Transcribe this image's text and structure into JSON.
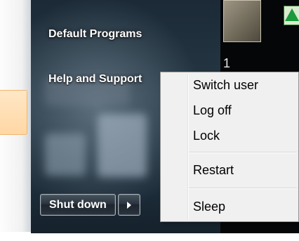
{
  "start_menu": {
    "items": [
      {
        "label": "Default Programs"
      },
      {
        "label": "Help and Support"
      }
    ],
    "shutdown_label": "Shut down"
  },
  "power_menu": {
    "items": [
      {
        "label": "Switch user"
      },
      {
        "label": "Log off"
      },
      {
        "label": "Lock"
      },
      {
        "label": "Restart"
      },
      {
        "label": "Sleep"
      }
    ]
  },
  "desktop": {
    "stray_text": "1"
  }
}
